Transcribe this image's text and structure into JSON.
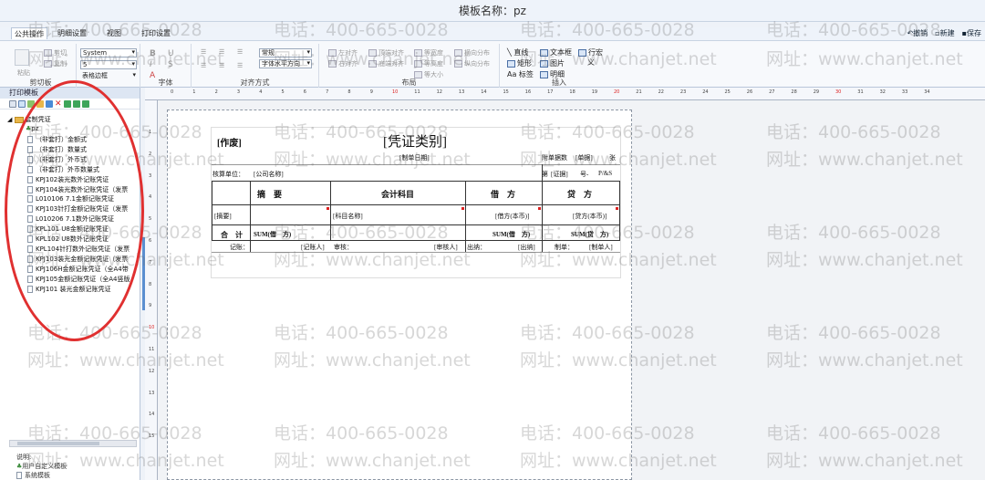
{
  "window": {
    "title": "模板名称：pz"
  },
  "ribbon_tabs": [
    "公共操作",
    "明细设置",
    "视图",
    "打印设置"
  ],
  "right_actions": [
    "撤销",
    "新建",
    "保存"
  ],
  "ribbon": {
    "clipboard": {
      "paste": "粘贴",
      "cut": "剪切",
      "copy": "复制",
      "label": "剪切板"
    },
    "font": {
      "name": "System",
      "size": "5",
      "border": "表格边框",
      "label": "字体"
    },
    "align": {
      "style": "常规",
      "horiz": "字体水平方向",
      "label": "对齐方式"
    },
    "layout": {
      "items": [
        "左对齐",
        "右对齐",
        "顶端对齐",
        "底端对齐",
        "等宽度",
        "等高度",
        "等大小",
        "横向分布",
        "纵向分布"
      ],
      "label": "布局"
    },
    "insert": {
      "items": [
        "直线",
        "矩形",
        "标签",
        "文本框",
        "图片",
        "明细",
        "行宏",
        "义"
      ],
      "label": "插入"
    }
  },
  "left_panel": {
    "title": "打印模板",
    "root": "套制凭证",
    "pz": "pz",
    "items": [
      "（非套打）金额式",
      "（非套打）数量式",
      "（非套打）外币式",
      "（非套打）外币数量式",
      "KPJ102装光数外记账凭证",
      "KPJ104装光数外记账凭证（发票",
      "L010106 7.1金额记账凭证",
      "KPJ103针打金额记账凭证（发票",
      "L010206 7.1数外记账凭证",
      "KPL101 U8金额记账凭证",
      "KPL102 U8数外记账凭证",
      "KPL104针打数外记账凭证（发票",
      "KPJ103装光金额记账凭证（发票",
      "KPJ106H金额记账凭证（全A4带",
      "KPJ105金额记账凭证（全A4竖版",
      "KPJ101 装光金额记账凭证"
    ],
    "footer_label": "说明:",
    "footer_items": [
      "用户自定义模板",
      "系统模板"
    ]
  },
  "ruler_h": [
    "0",
    "1",
    "2",
    "3",
    "4",
    "5",
    "6",
    "7",
    "8",
    "9",
    "10",
    "11",
    "12",
    "13",
    "14",
    "15",
    "16",
    "17",
    "18",
    "19",
    "20",
    "21",
    "22",
    "23",
    "24",
    "25",
    "26",
    "27",
    "28",
    "29",
    "30",
    "31",
    "32",
    "33",
    "34"
  ],
  "ruler_v": [
    "1",
    "2",
    "3",
    "4",
    "5",
    "6",
    "7",
    "8",
    "9",
    "10",
    "11",
    "12",
    "13",
    "14",
    "15"
  ],
  "form": {
    "zuofei": "[作废]",
    "title": "[凭证类别]",
    "zhidan_date": "[制单日期]",
    "fudan_label": "附单据数",
    "fudan_value": "[单据]",
    "zhang": "张",
    "danwei_label": "核算单位：",
    "danwei_value": "[公司名称]",
    "di": "第",
    "zheng_value": "[证据]",
    "hao": "号-",
    "page_fmt": "P/&S",
    "headers": [
      "摘　要",
      "会计科目",
      "借　方",
      "贷　方"
    ],
    "row": [
      "[摘要]",
      "[科目名称]",
      "[借方(本币)]",
      "[贷方(本币)]"
    ],
    "total_label": "合　计",
    "sum_left": "SUM(借　方)",
    "sum_debit": "SUM(借　方)",
    "sum_credit": "SUM(贷　方)",
    "sign_jizhang": "记账：",
    "sign_jizhangren": "[记账人]",
    "sign_shenhe": "审核：",
    "sign_shenheren": "[审核人]",
    "sign_chuna": "出纳：",
    "sign_chunaren": "[出纳]",
    "sign_zhidan": "制单：",
    "sign_zhidanren": "[制单人]"
  },
  "watermarks": {
    "phone": "电话：400-665-0028",
    "site": "网址：www.chanjet.net"
  },
  "colors": {
    "annotation_circle": "#e03030",
    "scroll_accent": "#5b8fd0"
  }
}
